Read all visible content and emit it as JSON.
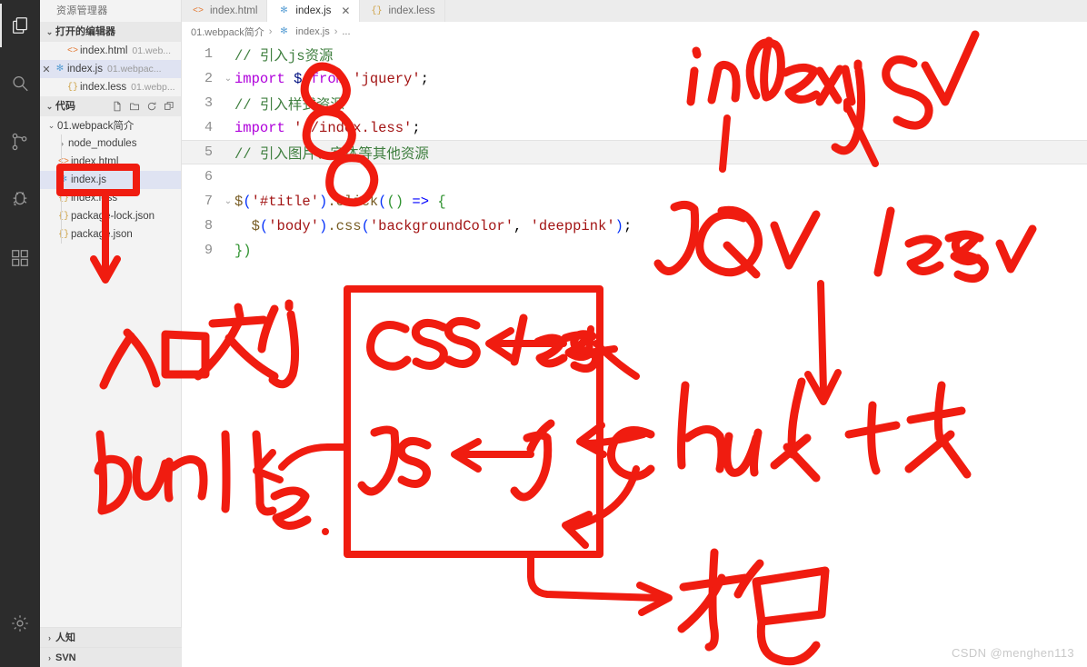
{
  "activitybar": {
    "items": [
      {
        "name": "explorer-icon",
        "label": "资源管理器",
        "active": true
      },
      {
        "name": "search-icon",
        "label": "搜索",
        "active": false
      },
      {
        "name": "source-control-icon",
        "label": "源代码管理",
        "active": false
      },
      {
        "name": "run-debug-icon",
        "label": "运行和调试",
        "active": false
      },
      {
        "name": "extensions-icon",
        "label": "扩展",
        "active": false
      },
      {
        "name": "settings-gear-icon",
        "label": "管理",
        "active": false
      }
    ]
  },
  "sidebar": {
    "title": "资源管理器",
    "open_editors": {
      "label": "打开的编辑器",
      "items": [
        {
          "icon": "html-file-icon",
          "name": "index.html",
          "path": "01.web...",
          "selected": false,
          "closable": false
        },
        {
          "icon": "js-file-icon",
          "name": "index.js",
          "path": "01.webpac...",
          "selected": true,
          "closable": true
        },
        {
          "icon": "less-file-icon",
          "name": "index.less",
          "path": "01.webp...",
          "selected": false,
          "closable": false
        }
      ]
    },
    "workspace": {
      "label": "代码",
      "tools": [
        "new-file-icon",
        "new-folder-icon",
        "refresh-icon",
        "collapse-all-icon"
      ],
      "tree": [
        {
          "label": "01.webpack简介",
          "depth": 0,
          "type": "folder",
          "expanded": true,
          "icon": "chevron-down-icon"
        },
        {
          "label": "node_modules",
          "depth": 1,
          "type": "folder",
          "expanded": false,
          "icon": "chevron-right-icon"
        },
        {
          "label": "index.html",
          "depth": 1,
          "type": "html",
          "icon": "html-file-icon"
        },
        {
          "label": "index.js",
          "depth": 1,
          "type": "js",
          "icon": "js-file-icon",
          "selected": true
        },
        {
          "label": "index.less",
          "depth": 1,
          "type": "less",
          "icon": "less-file-icon"
        },
        {
          "label": "package-lock.json",
          "depth": 1,
          "type": "json",
          "icon": "json-file-icon"
        },
        {
          "label": "package.json",
          "depth": 1,
          "type": "json",
          "icon": "json-file-icon"
        }
      ]
    },
    "bottom_sections": [
      {
        "label": "人知",
        "icon": "chevron-right-icon"
      },
      {
        "label": "SVN",
        "icon": "chevron-right-icon"
      }
    ]
  },
  "editor": {
    "tabs": [
      {
        "icon": "html-file-icon",
        "label": "index.html",
        "active": false,
        "closable": false
      },
      {
        "icon": "js-file-icon",
        "label": "index.js",
        "active": true,
        "closable": true,
        "close_label": "✕"
      },
      {
        "icon": "less-file-icon",
        "label": "index.less",
        "active": false,
        "closable": false
      }
    ],
    "breadcrumb": {
      "parts": [
        "01.webpack简介",
        "index.js",
        "..."
      ],
      "separator": "›"
    },
    "code_lines": [
      {
        "no": "1",
        "fold": "",
        "highlight": false
      },
      {
        "no": "2",
        "fold": "⌄",
        "highlight": false
      },
      {
        "no": "3",
        "fold": "",
        "highlight": false
      },
      {
        "no": "4",
        "fold": "",
        "highlight": false
      },
      {
        "no": "5",
        "fold": "",
        "highlight": true
      },
      {
        "no": "6",
        "fold": "",
        "highlight": false
      },
      {
        "no": "7",
        "fold": "⌄",
        "highlight": false
      },
      {
        "no": "8",
        "fold": "",
        "highlight": false
      },
      {
        "no": "9",
        "fold": "",
        "highlight": false
      }
    ],
    "code_text": {
      "l1": "// 引入js资源",
      "l2_kw": "import",
      "l2_var": " $ ",
      "l2_from": "from",
      "l2_str": " 'jquery'",
      "l2_semi": ";",
      "l3": "// 引入样式资源",
      "l4_kw": "import",
      "l4_str": " './index.less'",
      "l4_semi": ";",
      "l5": "// 引入图片、字体等其他资源",
      "l6": "",
      "l7_a": "$",
      "l7_b": "(",
      "l7_c": "'#title'",
      "l7_d": ")",
      "l7_e": ".click",
      "l7_f": "(",
      "l7_g": "()",
      "l7_h": " => ",
      "l7_i": "{",
      "l8_a": "  $",
      "l8_b": "(",
      "l8_c": "'body'",
      "l8_d": ")",
      "l8_e": ".css",
      "l8_f": "(",
      "l8_g": "'backgroundColor'",
      "l8_h": ", ",
      "l8_i": "'deeppink'",
      "l8_j": ")",
      "l8_k": ";",
      "l9": "})"
    }
  },
  "annotations": {
    "index_js": "index.js ✓",
    "jq": "JQ ✓",
    "less": "less ✓",
    "entry_file": "入口文件",
    "bundle": "bundle",
    "box_css": "css",
    "box_less": "less",
    "box_js_out": "js",
    "box_js_in": "js",
    "box_arrow": "←",
    "chunk": "chunk 块",
    "pack": "打包",
    "ink_color": "#f01c10"
  },
  "watermark": "CSDN @menghen113"
}
